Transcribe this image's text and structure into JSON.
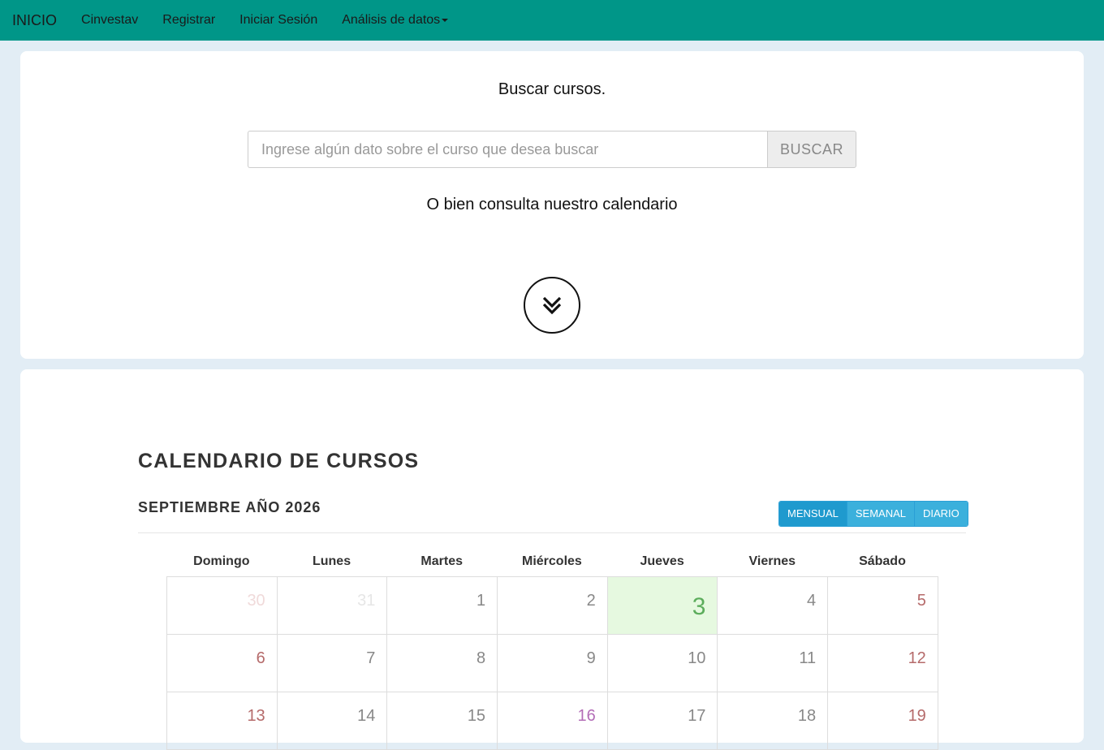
{
  "navbar": {
    "brand": "INICIO",
    "items": [
      "Cinvestav",
      "Registrar",
      "Iniciar Sesión"
    ],
    "dropdown_label": "Análisis de datos"
  },
  "search": {
    "title": "Buscar cursos.",
    "placeholder": "Ingrese algún dato sobre el curso que desea buscar",
    "button_label": "BUSCAR",
    "subtitle": "O bien consulta nuestro calendario",
    "scroll_icon": "double-chevron-down-icon"
  },
  "calendar": {
    "title": "CALENDARIO DE CURSOS",
    "month_label": "SEPTIEMBRE AÑO 2026",
    "views": [
      "MENSUAL",
      "SEMANAL",
      "DIARIO"
    ],
    "active_view": "MENSUAL",
    "weekdays": [
      "Domingo",
      "Lunes",
      "Martes",
      "Miércoles",
      "Jueves",
      "Viernes",
      "Sábado"
    ],
    "weeks": [
      [
        "30",
        "31",
        "1",
        "2",
        "3",
        "4",
        "5"
      ],
      [
        "6",
        "7",
        "8",
        "9",
        "10",
        "11",
        "12"
      ],
      [
        "13",
        "14",
        "15",
        "16",
        "17",
        "18",
        "19"
      ]
    ],
    "today": "3",
    "event_days": [
      "16"
    ],
    "colors": {
      "navbar": "#009688",
      "today_bg": "#e6f9e0",
      "today_text": "#5cad5c",
      "weekend_text": "#b56a6a",
      "event_text": "#b36db7",
      "view_active": "#1f9ace",
      "view_button": "#3bb0dc"
    }
  }
}
